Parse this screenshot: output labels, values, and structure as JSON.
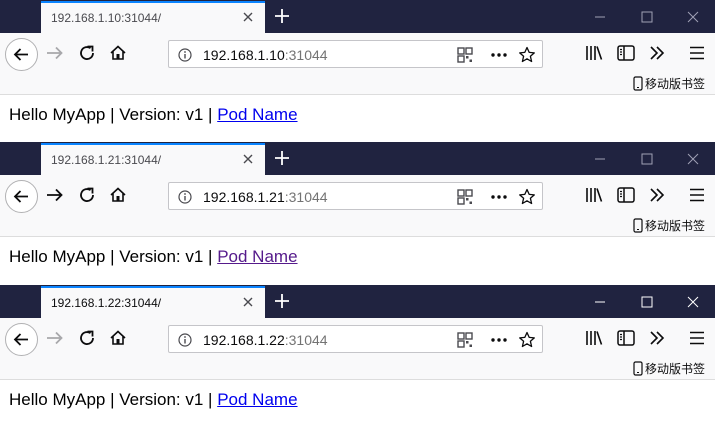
{
  "colors": {
    "titlebar": "#202340",
    "tab_accent": "#0a84ff",
    "link": "#0000ee",
    "visited_link": "#551a8b"
  },
  "icons": [
    "back-arrow-icon",
    "forward-arrow-icon",
    "reload-icon",
    "home-icon",
    "info-icon",
    "qr-code-icon",
    "more-actions-icon",
    "star-icon",
    "library-icon",
    "sidebar-icon",
    "overflow-chevron-icon",
    "hamburger-menu-icon",
    "mobile-phone-icon",
    "close-icon",
    "plus-icon",
    "minimize-icon",
    "maximize-icon"
  ],
  "windows": [
    {
      "tab_title": "192.168.1.10:31044/",
      "url_host": "192.168.1.10",
      "url_port": ":31044",
      "bookmark_label": "移动版书签",
      "content": {
        "text": "Hello MyApp | Version: v1 | ",
        "link_text": "Pod Name"
      }
    },
    {
      "tab_title": "192.168.1.21:31044/",
      "url_host": "192.168.1.21",
      "url_port": ":31044",
      "bookmark_label": "移动版书签",
      "content": {
        "text": "Hello MyApp | Version: v1 | ",
        "link_text": "Pod Name"
      }
    },
    {
      "tab_title": "192.168.1.22:31044/",
      "url_host": "192.168.1.22",
      "url_port": ":31044",
      "bookmark_label": "移动版书签",
      "content": {
        "text": "Hello MyApp | Version: v1 | ",
        "link_text": "Pod Name"
      }
    }
  ]
}
